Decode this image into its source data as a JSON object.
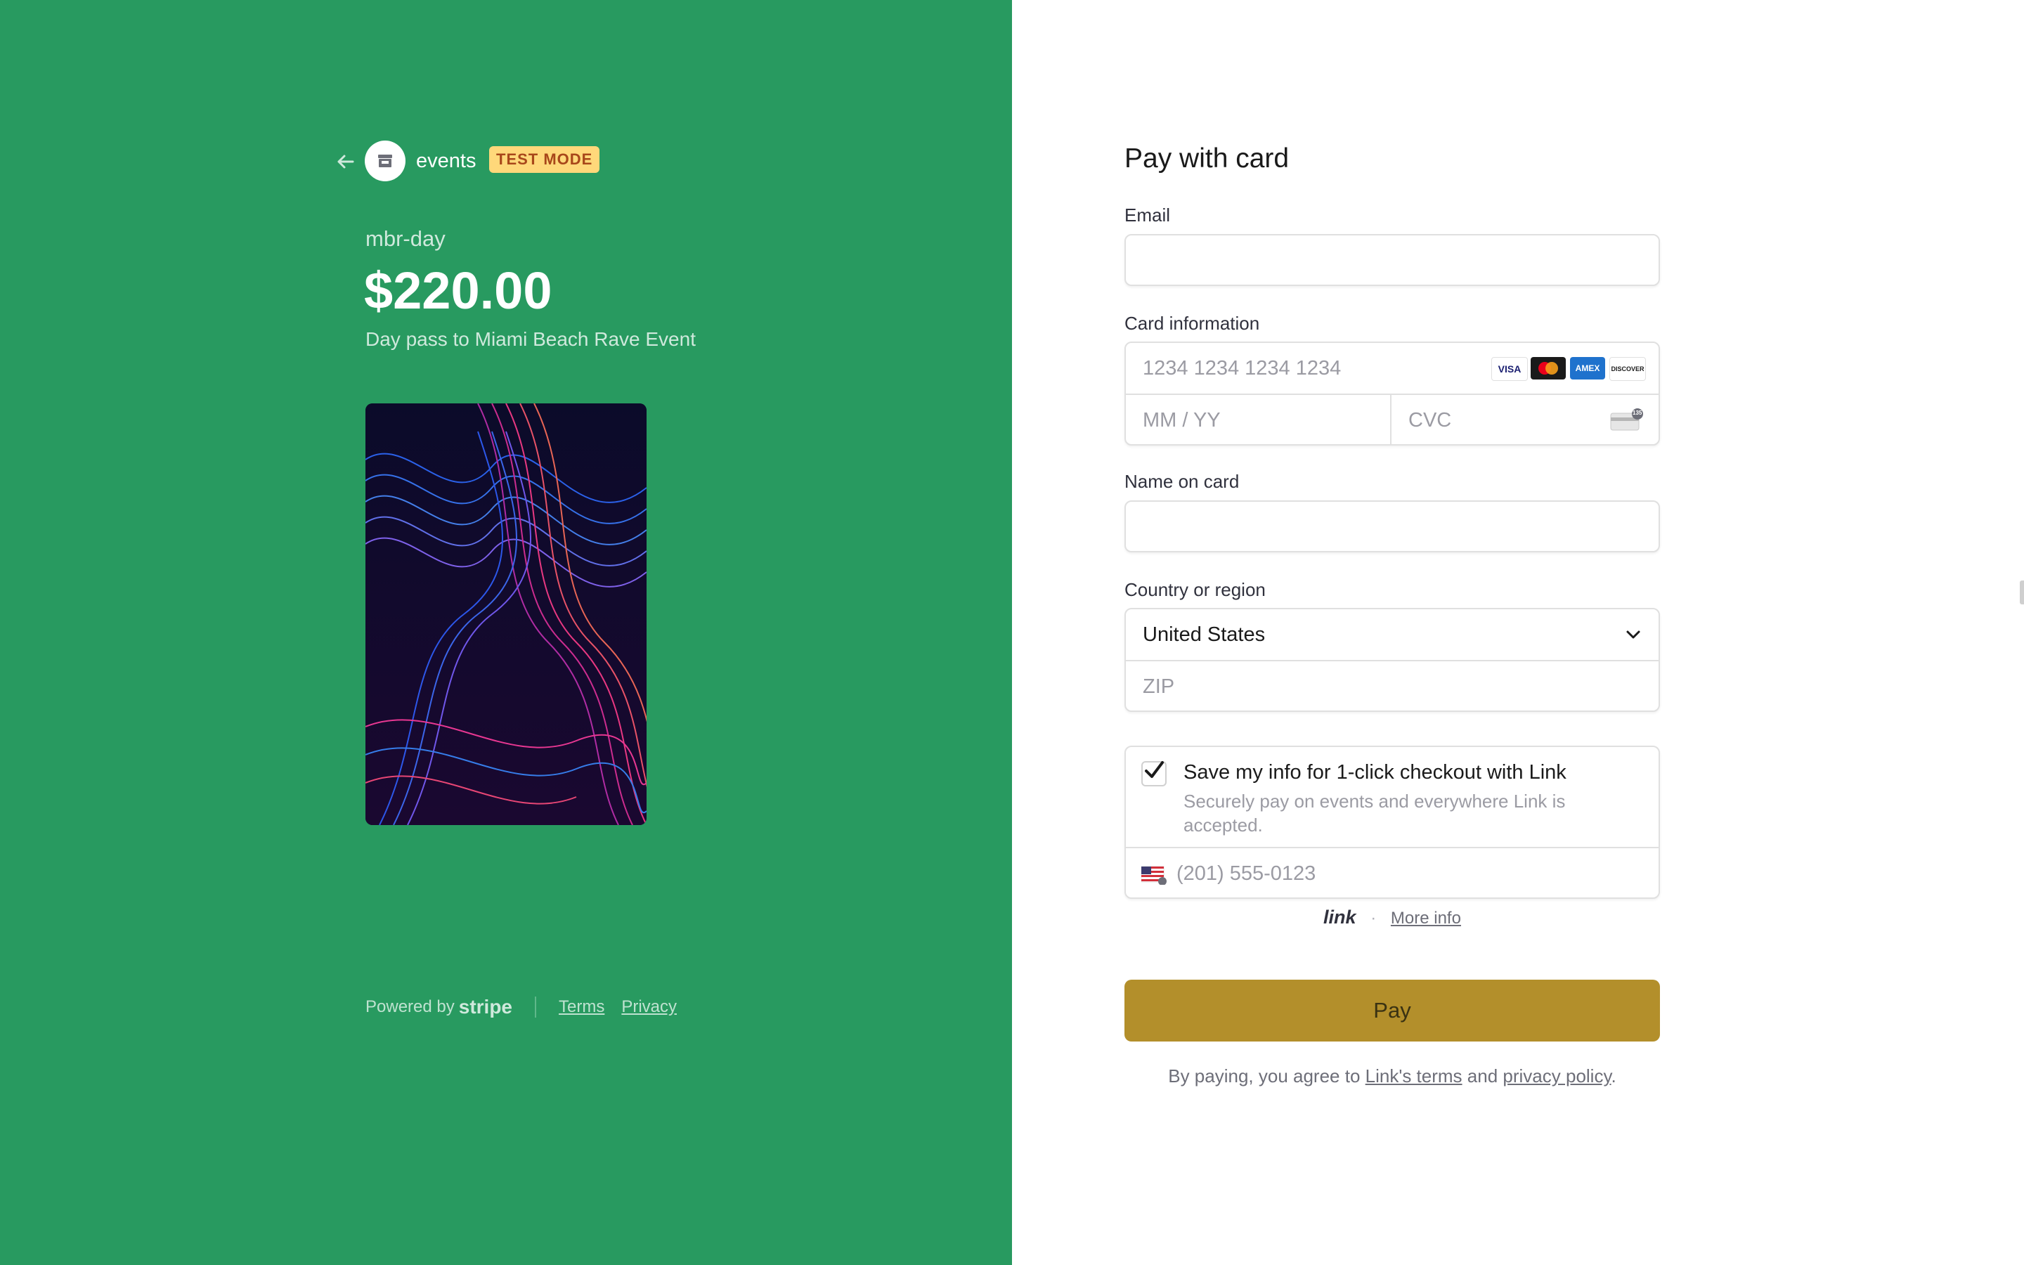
{
  "merchant": {
    "name": "events",
    "badge": "TEST MODE"
  },
  "product": {
    "name": "mbr-day",
    "price": "$220.00",
    "description": "Day pass to Miami Beach Rave Event"
  },
  "footer": {
    "powered_by": "Powered by",
    "brand": "stripe",
    "terms": "Terms",
    "privacy": "Privacy"
  },
  "form": {
    "title": "Pay with card",
    "email_label": "Email",
    "email_value": "",
    "card_label": "Card information",
    "card_number_placeholder": "1234 1234 1234 1234",
    "expiry_placeholder": "MM / YY",
    "cvc_placeholder": "CVC",
    "cvc_badge": "135",
    "name_label": "Name on card",
    "name_value": "",
    "country_label": "Country or region",
    "country_value": "United States",
    "zip_placeholder": "ZIP",
    "link_save_title": "Save my info for 1-click checkout with Link",
    "link_save_desc": "Securely pay on events and everywhere Link is accepted.",
    "link_save_checked": true,
    "phone_placeholder": "(201) 555-0123",
    "link_logo": "link",
    "link_separator": "·",
    "more_info": "More info",
    "pay_label": "Pay",
    "terms_prefix": "By paying, you agree to",
    "terms_link": "Link's terms",
    "terms_and": "and",
    "privacy_link": "privacy policy",
    "terms_suffix": "."
  },
  "card_brands": [
    "VISA",
    "MC",
    "AMEX",
    "DISCOVER"
  ],
  "colors": {
    "left_bg": "#289a60",
    "pay_button": "#b38f2b",
    "badge_bg": "#ffd87a",
    "badge_text": "#a8471a"
  }
}
